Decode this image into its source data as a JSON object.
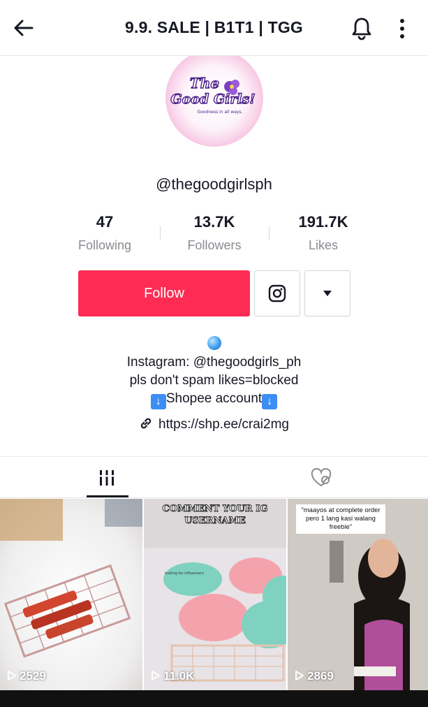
{
  "header": {
    "title": "9.9. SALE | B1T1 | TGG",
    "icons": {
      "back": "arrow-left-icon",
      "notifications": "bell-icon",
      "more": "vertical-dots-icon"
    }
  },
  "profile": {
    "username": "@thegoodgirlsph",
    "avatar_icon": "the-good-girls-logo",
    "stats": [
      {
        "value": "47",
        "label": "Following"
      },
      {
        "value": "13.7K",
        "label": "Followers"
      },
      {
        "value": "191.7K",
        "label": "Likes"
      }
    ],
    "follow_label": "Follow",
    "bio_lines": [
      "Instagram: @thegoodgirls_ph",
      "pls don't spam likes=blocked",
      "Shopee account"
    ],
    "link": "https://shp.ee/crai2mg"
  },
  "tabs": [
    {
      "name": "videos",
      "icon": "grid-bars-icon",
      "active": true
    },
    {
      "name": "liked",
      "icon": "liked-hidden-icon",
      "active": false
    }
  ],
  "videos": [
    {
      "views": "2529"
    },
    {
      "views": "11.0K",
      "caption": "COMMENT YOUR IG USERNAME"
    },
    {
      "views": "2869",
      "caption": "\"maayos at complete order pero 1 lang kasi walang freebie\""
    }
  ],
  "colors": {
    "accent": "#fe2c55",
    "text": "#161823",
    "muted": "#8a8b91"
  }
}
